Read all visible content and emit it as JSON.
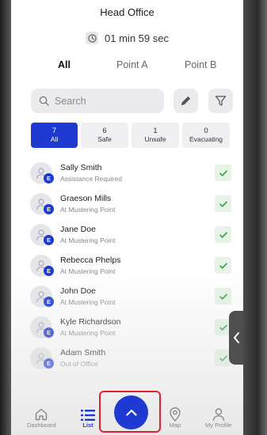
{
  "header": {
    "title": "Head Office",
    "timer": "01 min 59 sec"
  },
  "tabs": [
    {
      "label": "All",
      "active": true
    },
    {
      "label": "Point A",
      "active": false
    },
    {
      "label": "Point B",
      "active": false
    }
  ],
  "search": {
    "placeholder": "Search"
  },
  "filters": [
    {
      "count": "7",
      "label": "All",
      "active": true
    },
    {
      "count": "6",
      "label": "Safe",
      "active": false
    },
    {
      "count": "1",
      "label": "Unsafe",
      "active": false
    },
    {
      "count": "0",
      "label": "Evacuating",
      "active": false
    }
  ],
  "people": [
    {
      "name": "Sally Smith",
      "status": "Assistance Required",
      "badge": "E"
    },
    {
      "name": "Graeson Mills",
      "status": "At Mustering Point",
      "badge": "E"
    },
    {
      "name": "Jane Doe",
      "status": "At Mustering Point",
      "badge": "E"
    },
    {
      "name": "Rebecca Phelps",
      "status": "At Mustering Point",
      "badge": "E"
    },
    {
      "name": "John Doe",
      "status": "At Mustering Point",
      "badge": "E"
    },
    {
      "name": "Kyle Richardson",
      "status": "At Mustering Point",
      "badge": "E"
    },
    {
      "name": "Adam Smith",
      "status": "Out of Office",
      "badge": "E"
    }
  ],
  "nav": [
    {
      "label": "Dashboard",
      "icon": "home-icon",
      "active": false
    },
    {
      "label": "List",
      "icon": "list-icon",
      "active": true
    },
    {
      "label": "Map",
      "icon": "map-pin-icon",
      "active": false
    },
    {
      "label": "My Profile",
      "icon": "user-icon",
      "active": false
    }
  ],
  "colors": {
    "accent": "#1f3ad1",
    "check_bg": "#e6f3e6",
    "check": "#2e9e3e",
    "highlight": "#e0202a"
  }
}
